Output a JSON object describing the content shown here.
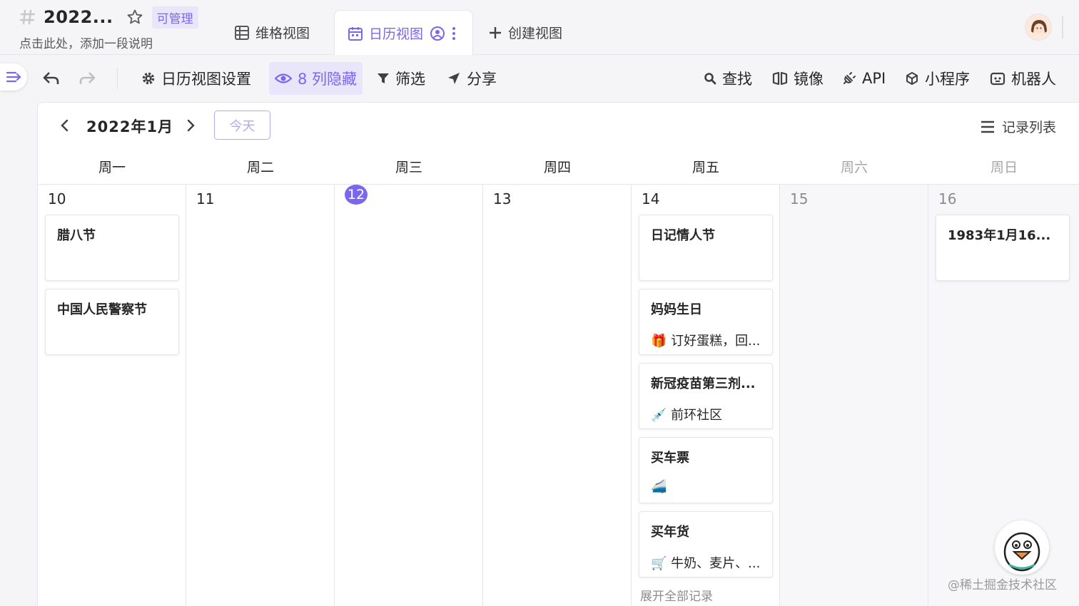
{
  "header": {
    "title": "2022...",
    "badge": "可管理",
    "subtitle": "点击此处，添加一段说明",
    "tabs": [
      {
        "label": "维格视图",
        "icon": "grid-view-icon"
      },
      {
        "label": "日历视图",
        "icon": "calendar-icon",
        "active": true
      },
      {
        "label": "创建视图",
        "icon": "plus-icon"
      }
    ]
  },
  "toolbar": {
    "settings": "日历视图设置",
    "hidden_columns": "8 列隐藏",
    "filter": "筛选",
    "share": "分享",
    "find": "查找",
    "mirror": "镜像",
    "api": "API",
    "mini_program": "小程序",
    "robot": "机器人"
  },
  "calendar": {
    "month": "2022年1月",
    "today_button": "今天",
    "record_list": "记录列表",
    "weekdays": [
      "周一",
      "周二",
      "周三",
      "周四",
      "周五",
      "周六",
      "周日"
    ],
    "days": [
      {
        "date": "10",
        "events": [
          {
            "title": "腊八节",
            "note": ""
          },
          {
            "title": "中国人民警察节",
            "note": ""
          }
        ]
      },
      {
        "date": "11",
        "events": []
      },
      {
        "date": "12",
        "today": true,
        "events": []
      },
      {
        "date": "13",
        "events": []
      },
      {
        "date": "14",
        "events": [
          {
            "title": "日记情人节",
            "note": ""
          },
          {
            "title": "妈妈生日",
            "note": "🎁 订好蛋糕，回..."
          },
          {
            "title": "新冠疫苗第三剂...",
            "note": "💉 前环社区"
          },
          {
            "title": "买车票",
            "note": "🚄"
          },
          {
            "title": "买年货",
            "note": "🛒 牛奶、麦片、..."
          }
        ],
        "expand_link": "展开全部记录"
      },
      {
        "date": "15",
        "events": []
      },
      {
        "date": "16",
        "events": [
          {
            "title": "1983年1月16...",
            "note": ""
          }
        ]
      }
    ]
  },
  "watermark": "@稀土掘金技术社区",
  "colors": {
    "accent": "#7b67ee",
    "accent_light": "#e9e5fb",
    "background": "#f5f5f7",
    "border": "#e5e5ea"
  }
}
